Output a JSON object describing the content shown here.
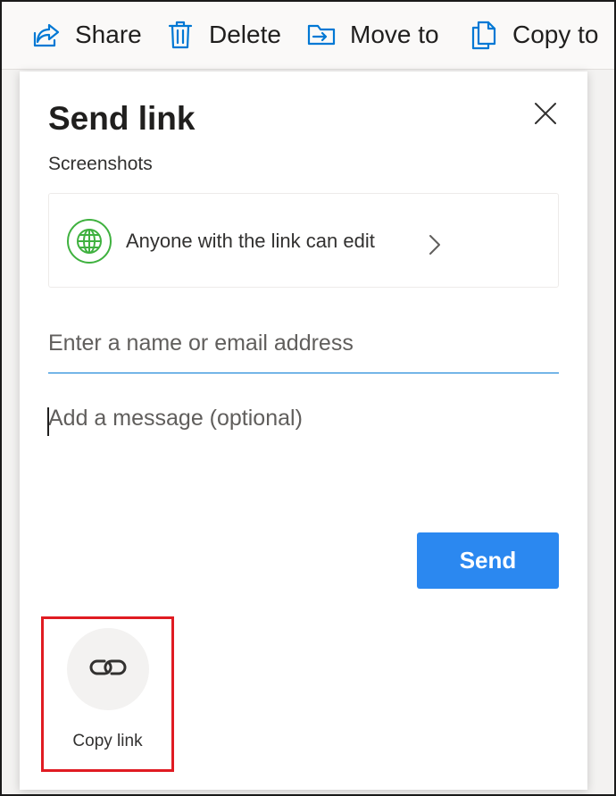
{
  "toolbar": {
    "share_label": "Share",
    "delete_label": "Delete",
    "move_label": "Move to",
    "copy_label": "Copy to",
    "icons": [
      "share-icon",
      "trash-icon",
      "move-to-icon",
      "copy-icon"
    ],
    "accent_color": "#0078d4"
  },
  "dialog": {
    "title": "Send link",
    "subtitle": "Screenshots",
    "permission": {
      "text": "Anyone with the link can edit",
      "icon": "globe-icon",
      "icon_color": "#3fb13f"
    },
    "recipient_input": {
      "placeholder": "Enter a name or email address",
      "value": ""
    },
    "message_input": {
      "placeholder": "Add a message (optional)",
      "value": ""
    },
    "send_label": "Send",
    "send_color": "#2b88f0",
    "copy_link_label": "Copy link",
    "highlight_color": "#e01b22"
  }
}
